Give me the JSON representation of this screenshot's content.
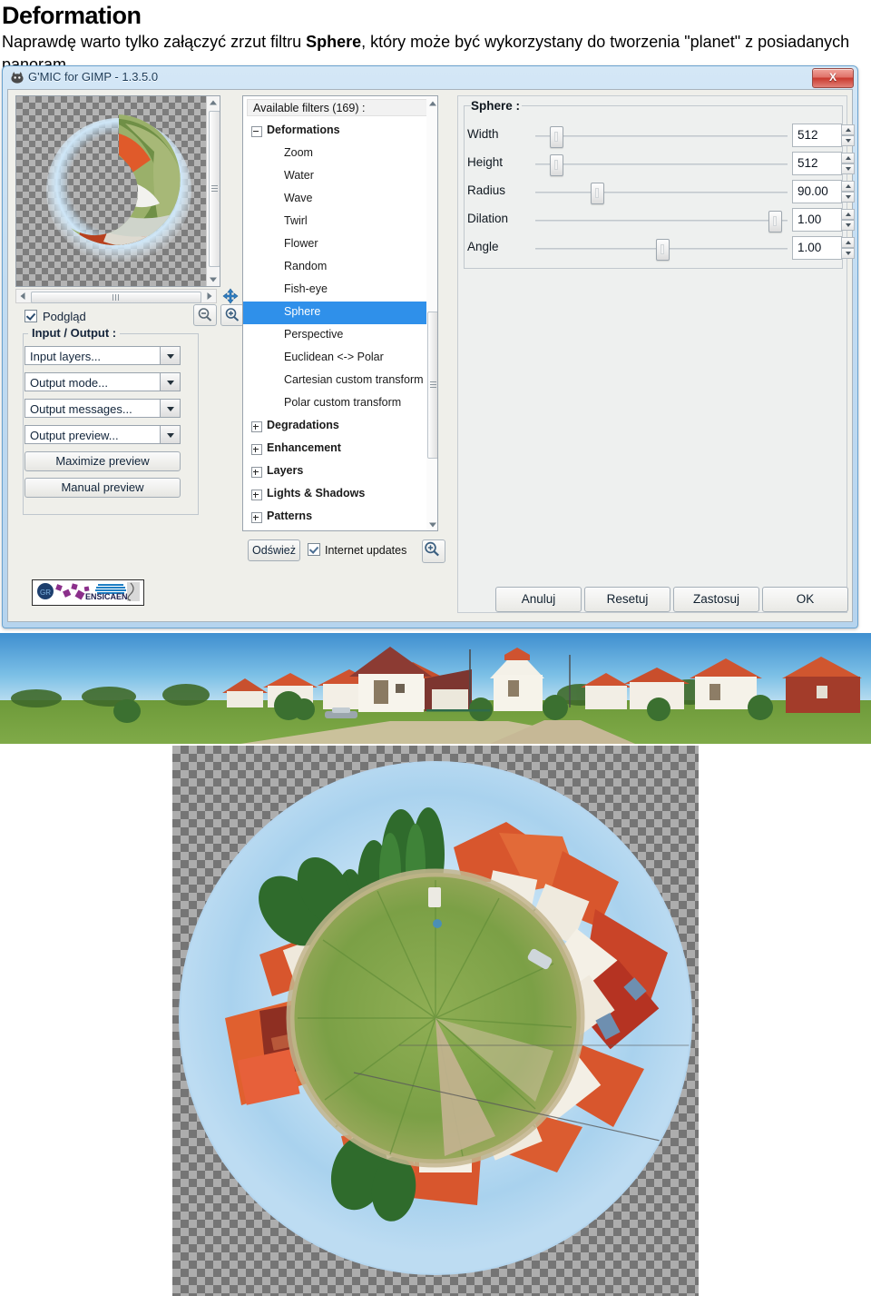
{
  "document": {
    "title": "Deformation",
    "paragraph_pre": "Naprawdę warto tylko załączyć zrzut filtru ",
    "paragraph_bold": "Sphere",
    "paragraph_post": ", który może być wykorzystany do tworzenia \"planet\" z posiadanych panoram."
  },
  "window": {
    "title": "G'MIC for GIMP - 1.3.5.0",
    "close_label": "X"
  },
  "preview": {
    "checkbox_label": "Podgląd",
    "checked": true,
    "zoom_out_icon": "zoom-out-icon",
    "zoom_in_icon": "zoom-in-icon",
    "pan_icon": "move-icon"
  },
  "io_panel": {
    "legend": "Input / Output :",
    "combos": [
      {
        "label": "Input layers..."
      },
      {
        "label": "Output mode..."
      },
      {
        "label": "Output messages..."
      },
      {
        "label": "Output preview..."
      }
    ],
    "buttons": [
      {
        "label": "Maximize preview",
        "mnemonic": "e"
      },
      {
        "label": "Manual preview",
        "mnemonic": "M"
      }
    ]
  },
  "branding": {
    "logo_text": "ENSICAEN"
  },
  "filters": {
    "header": "Available filters (169) :",
    "items": [
      {
        "label": "Deformations",
        "type": "category",
        "expanded": true
      },
      {
        "label": "Zoom",
        "type": "leaf",
        "selected": false
      },
      {
        "label": "Water",
        "type": "leaf",
        "selected": false
      },
      {
        "label": "Wave",
        "type": "leaf",
        "selected": false
      },
      {
        "label": "Twirl",
        "type": "leaf",
        "selected": false
      },
      {
        "label": "Flower",
        "type": "leaf",
        "selected": false
      },
      {
        "label": "Random",
        "type": "leaf",
        "selected": false
      },
      {
        "label": "Fish-eye",
        "type": "leaf",
        "selected": false
      },
      {
        "label": "Sphere",
        "type": "leaf",
        "selected": true
      },
      {
        "label": "Perspective",
        "type": "leaf",
        "selected": false
      },
      {
        "label": "Euclidean <-> Polar",
        "type": "leaf",
        "selected": false
      },
      {
        "label": "Cartesian custom transform",
        "type": "leaf",
        "selected": false
      },
      {
        "label": "Polar custom transform",
        "type": "leaf",
        "selected": false
      },
      {
        "label": "Degradations",
        "type": "category",
        "expanded": false
      },
      {
        "label": "Enhancement",
        "type": "category",
        "expanded": false
      },
      {
        "label": "Layers",
        "type": "category",
        "expanded": false
      },
      {
        "label": "Lights & Shadows",
        "type": "category",
        "expanded": false
      },
      {
        "label": "Patterns",
        "type": "category",
        "expanded": false
      }
    ],
    "refresh_label": "Odśwież",
    "internet_updates_label": "Internet updates",
    "internet_updates_checked": true,
    "magnifier_icon": "zoom-in-icon"
  },
  "parameters": {
    "legend": "Sphere :",
    "rows": [
      {
        "label": "Width",
        "value": "512",
        "thumb_pct": 6
      },
      {
        "label": "Height",
        "value": "512",
        "thumb_pct": 6
      },
      {
        "label": "Radius",
        "value": "90.00",
        "thumb_pct": 23
      },
      {
        "label": "Dilation",
        "value": "1.00",
        "thumb_pct": 97
      },
      {
        "label": "Angle",
        "value": "1.00",
        "thumb_pct": 50
      }
    ]
  },
  "actions": [
    {
      "label": "Anuluj",
      "mnemonic": "A"
    },
    {
      "label": "Resetuj",
      "mnemonic": "R"
    },
    {
      "label": "Zastosuj",
      "mnemonic": "Z"
    },
    {
      "label": "OK",
      "mnemonic": "O"
    }
  ],
  "images": {
    "panorama_caption": "panorama-photo-of-housing-estate",
    "planet_caption": "little-planet-stereographic-projection"
  }
}
